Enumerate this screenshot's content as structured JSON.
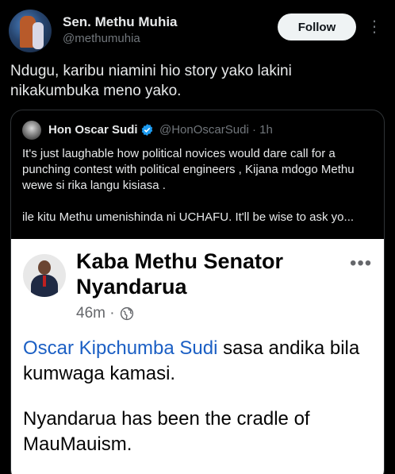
{
  "post": {
    "author_name": "Sen. Methu Muhia",
    "author_handle": "@methumuhia",
    "follow_label": "Follow",
    "more_icon": "⋮",
    "text": "Ndugu, karibu niamini hio story yako lakini nikakumbuka meno yako."
  },
  "quote": {
    "name": "Hon Oscar Sudi",
    "handle_time": "@HonOscarSudi · 1h",
    "line1": "It's just laughable how political novices would dare call for a punching contest with political engineers , Kijana mdogo Methu  wewe si rika langu kisiasa .",
    "line2": "ile kitu Methu umenishinda ni UCHAFU. It'll be wise to ask yo..."
  },
  "fb_post": {
    "name": "Kaba Methu Senator Nyandarua",
    "time": "46m ·",
    "dots": "•••",
    "mention": "Oscar Kipchumba Sudi",
    "text_after_mention": " sasa andika bila kumwaga kamasi.",
    "paragraph2": "Nyandarua has been the cradle of MauMauism."
  },
  "colors": {
    "background": "#000000",
    "verified_blue": "#1d9bf0",
    "link_blue": "#1b5fc4"
  }
}
